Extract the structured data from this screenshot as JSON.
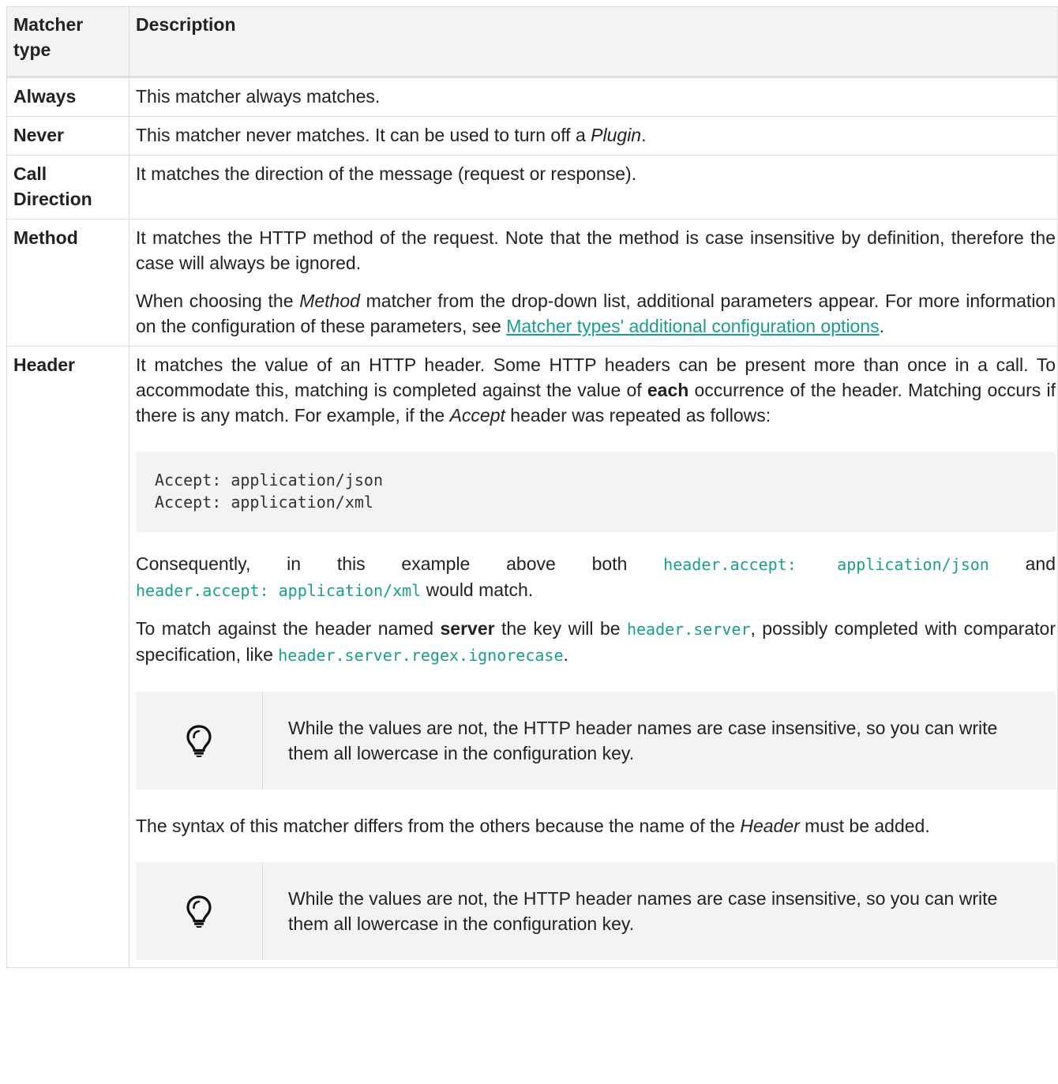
{
  "table": {
    "headers": [
      "Matcher type",
      "Description"
    ],
    "rows": [
      {
        "type": "Always",
        "desc": "This matcher always matches."
      },
      {
        "type": "Never",
        "desc_pre": "This matcher never matches. It can be used to turn off a ",
        "desc_em": "Plugin",
        "desc_post": "."
      },
      {
        "type": "Call Direction",
        "desc": "It matches the direction of the message (request or response)."
      },
      {
        "type": "Method",
        "p1": "It matches the HTTP method of the request. Note that the method is case insensitive by definition, therefore the case will always be ignored.",
        "p2_pre": "When choosing the ",
        "p2_em": "Method",
        "p2_mid": " matcher from the drop-down list, additional parameters appear. For more information on the configuration of these parameters, see ",
        "p2_link": "Matcher types' additional configuration options",
        "p2_post": "."
      },
      {
        "type": "Header",
        "p1_a": "It matches the value of an HTTP header. Some HTTP headers can be present more than once in a call. To accommodate this, matching is completed against the value of ",
        "p1_b": "each",
        "p1_c": " occurrence of the header. Matching occurs if there is any match. For example, if the ",
        "p1_d": "Accept",
        "p1_e": " header was repeated as follows:",
        "code_lines": [
          "Accept: application/json",
          "Accept: application/xml"
        ],
        "p2_a": "Consequently, in this example above both ",
        "p2_code1": "header.accept: application/json",
        "p2_b": " and ",
        "p2_code2": "header.accept: application/xml",
        "p2_c": " would match.",
        "p3_a": "To match against the header named ",
        "p3_b": "server",
        "p3_c": " the key will be ",
        "p3_code1": "header.server",
        "p3_d": ", possibly completed with comparator specification, like ",
        "p3_code2": "header.server.regex.ignorecase",
        "p3_e": ".",
        "tip1": "While the values are not, the HTTP header names are case insensitive, so you can write them all lowercase in the configuration key.",
        "p4_a": "The syntax of this matcher differs from the others because the name of the ",
        "p4_b": "Header",
        "p4_c": " must be added.",
        "tip2": "While the values are not, the HTTP header names are case insensitive, so you can write them all lowercase in the configuration key."
      }
    ]
  },
  "icons": {
    "tip": "lightbulb-icon"
  }
}
